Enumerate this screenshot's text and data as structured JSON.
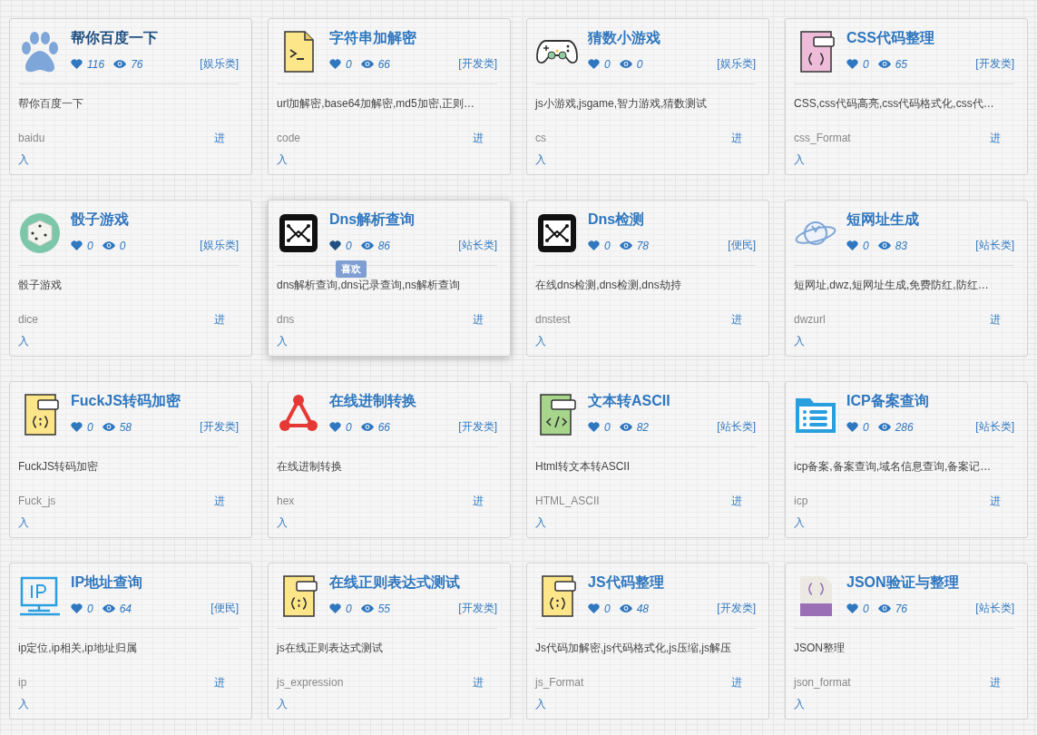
{
  "cards": [
    {
      "title": "帮你百度一下",
      "likes": "116",
      "views": "76",
      "category": "[娱乐类]",
      "description": "帮你百度一下",
      "code": "baidu",
      "link_lines": [
        "进",
        "入"
      ],
      "visited": true,
      "hovered": false
    },
    {
      "title": "字符串加解密",
      "likes": "0",
      "views": "66",
      "category": "[开发类]",
      "description": "url加解密,base64加解密,md5加密,正则…",
      "code": "code",
      "link_lines": [
        "进",
        "入"
      ],
      "visited": false,
      "hovered": false
    },
    {
      "title": "猜数小游戏",
      "likes": "0",
      "views": "0",
      "category": "[娱乐类]",
      "description": "js小游戏,jsgame,智力游戏,猜数测试",
      "code": "cs",
      "link_lines": [
        "进",
        "入"
      ],
      "visited": false,
      "hovered": false
    },
    {
      "title": "CSS代码整理",
      "likes": "0",
      "views": "65",
      "category": "[开发类]",
      "description": "CSS,css代码高亮,css代码格式化,css代…",
      "code": "css_Format",
      "link_lines": [
        "进",
        "入"
      ],
      "visited": false,
      "hovered": false
    },
    {
      "title": "骰子游戏",
      "likes": "0",
      "views": "0",
      "category": "[娱乐类]",
      "description": "骰子游戏",
      "code": "dice",
      "link_lines": [
        "进",
        "入"
      ],
      "visited": false,
      "hovered": false
    },
    {
      "title": "Dns解析查询",
      "likes": "0",
      "views": "86",
      "category": "[站长类]",
      "description": "dns解析查询,dns记录查询,ns解析查询",
      "code": "dns",
      "link_lines": [
        "进",
        "入"
      ],
      "visited": false,
      "hovered": true,
      "tooltip": "喜欢"
    },
    {
      "title": "Dns检测",
      "likes": "0",
      "views": "78",
      "category": "[便民]",
      "description": "在线dns检测,dns检测,dns劫持",
      "code": "dnstest",
      "link_lines": [
        "进",
        "入"
      ],
      "visited": false,
      "hovered": false
    },
    {
      "title": "短网址生成",
      "likes": "0",
      "views": "83",
      "category": "[站长类]",
      "description": "短网址,dwz,短网址生成,免费防红,防红…",
      "code": "dwzurl",
      "link_lines": [
        "进",
        "入"
      ],
      "visited": false,
      "hovered": false
    },
    {
      "title": "FuckJS转码加密",
      "likes": "0",
      "views": "58",
      "category": "[开发类]",
      "description": "FuckJS转码加密",
      "code": "Fuck_js",
      "link_lines": [
        "进",
        "入"
      ],
      "visited": false,
      "hovered": false
    },
    {
      "title": "在线进制转换",
      "likes": "0",
      "views": "66",
      "category": "[开发类]",
      "description": "在线进制转换",
      "code": "hex",
      "link_lines": [
        "进",
        "入"
      ],
      "visited": false,
      "hovered": false
    },
    {
      "title": "文本转ASCII",
      "likes": "0",
      "views": "82",
      "category": "[站长类]",
      "description": "Html转文本转ASCII",
      "code": "HTML_ASCII",
      "link_lines": [
        "进",
        "入"
      ],
      "visited": false,
      "hovered": false
    },
    {
      "title": "ICP备案查询",
      "likes": "0",
      "views": "286",
      "category": "[站长类]",
      "description": "icp备案,备案查询,域名信息查询,备案记…",
      "code": "icp",
      "link_lines": [
        "进",
        "入"
      ],
      "visited": false,
      "hovered": false
    },
    {
      "title": "IP地址查询",
      "likes": "0",
      "views": "64",
      "category": "[便民]",
      "description": "ip定位,ip相关,ip地址归属",
      "code": "ip",
      "link_lines": [
        "进",
        "入"
      ],
      "visited": false,
      "hovered": false
    },
    {
      "title": "在线正则表达式测试",
      "likes": "0",
      "views": "55",
      "category": "[开发类]",
      "description": "js在线正则表达式测试",
      "code": "js_expression",
      "link_lines": [
        "进",
        "入"
      ],
      "visited": false,
      "hovered": false
    },
    {
      "title": "JS代码整理",
      "likes": "0",
      "views": "48",
      "category": "[开发类]",
      "description": "Js代码加解密,js代码格式化,js压缩,js解压",
      "code": "js_Format",
      "link_lines": [
        "进",
        "入"
      ],
      "visited": false,
      "hovered": false
    },
    {
      "title": "JSON验证与整理",
      "likes": "0",
      "views": "76",
      "category": "[站长类]",
      "description": "JSON整理",
      "code": "json_format",
      "link_lines": [
        "进",
        "入"
      ],
      "visited": false,
      "hovered": false
    }
  ]
}
